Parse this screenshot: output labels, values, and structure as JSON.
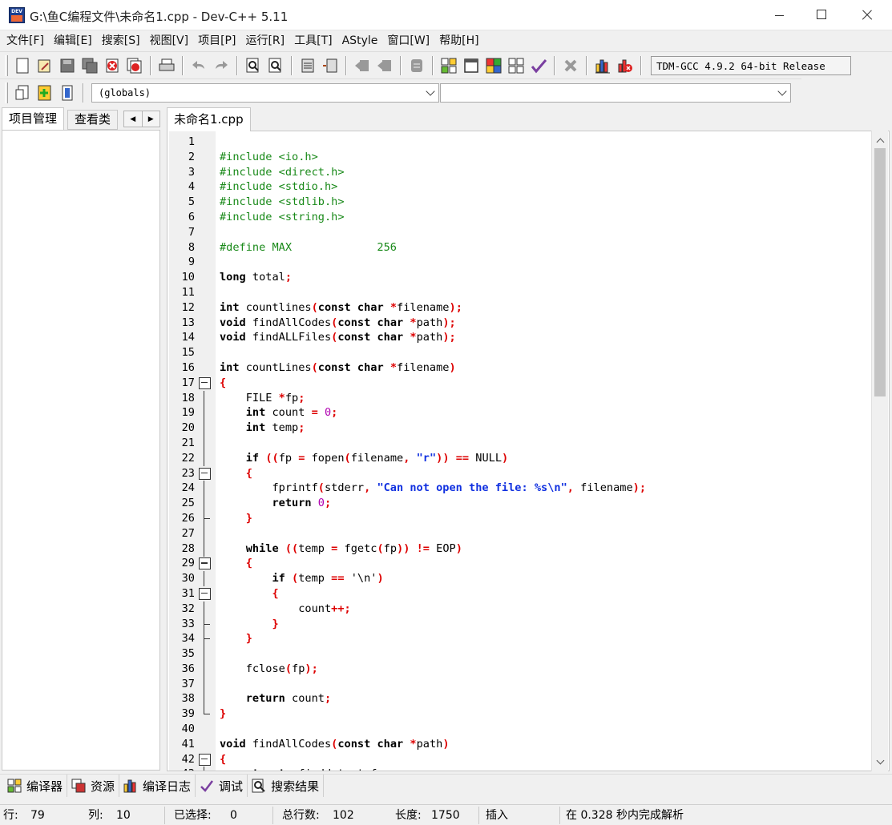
{
  "window": {
    "title": "G:\\鱼C编程文件\\未命名1.cpp - Dev-C++ 5.11"
  },
  "menu": [
    "文件[F]",
    "编辑[E]",
    "搜索[S]",
    "视图[V]",
    "项目[P]",
    "运行[R]",
    "工具[T]",
    "AStyle",
    "窗口[W]",
    "帮助[H]"
  ],
  "toolbar": {
    "compiler": "TDM-GCC 4.9.2 64-bit Release"
  },
  "toolbar2": {
    "class_combo": "(globals)",
    "func_combo": ""
  },
  "left_panel": {
    "tabs": [
      "项目管理",
      "查看类"
    ]
  },
  "editor": {
    "tab": "未命名1.cpp",
    "lines": [
      "",
      "#include <io.h>",
      "#include <direct.h>",
      "#include <stdio.h>",
      "#include <stdlib.h>",
      "#include <string.h>",
      "",
      "#define MAX             256",
      "",
      "long total;",
      "",
      "int countlines(const char *filename);",
      "void findAllCodes(const char *path);",
      "void findALLFiles(const char *path);",
      "",
      "int countLines(const char *filename)",
      "{",
      "    FILE *fp;",
      "    int count = 0;",
      "    int temp;",
      "",
      "    if ((fp = fopen(filename, \"r\")) == NULL)",
      "    {",
      "        fprintf(stderr, \"Can not open the file: %s\\n\", filename);",
      "        return 0;",
      "    }",
      "",
      "    while ((temp = fgetc(fp)) != EOP)",
      "    {",
      "        if (temp == '\\n')",
      "        {",
      "            count++;",
      "        }",
      "    }",
      "",
      "    fclose(fp);",
      "",
      "    return count;",
      "}",
      "",
      "void findAllCodes(const char *path)",
      "{",
      "    struct _finddata_t fa;"
    ]
  },
  "bottom_tabs": [
    "编译器",
    "资源",
    "编译日志",
    "调试",
    "搜索结果"
  ],
  "status": {
    "row_label": "行:",
    "row": "79",
    "col_label": "列:",
    "col": "10",
    "sel_label": "已选择:",
    "sel": "0",
    "total_label": "总行数:",
    "total": "102",
    "len_label": "长度:",
    "len": "1750",
    "mode": "插入",
    "parse": "在 0.328 秒内完成解析"
  }
}
